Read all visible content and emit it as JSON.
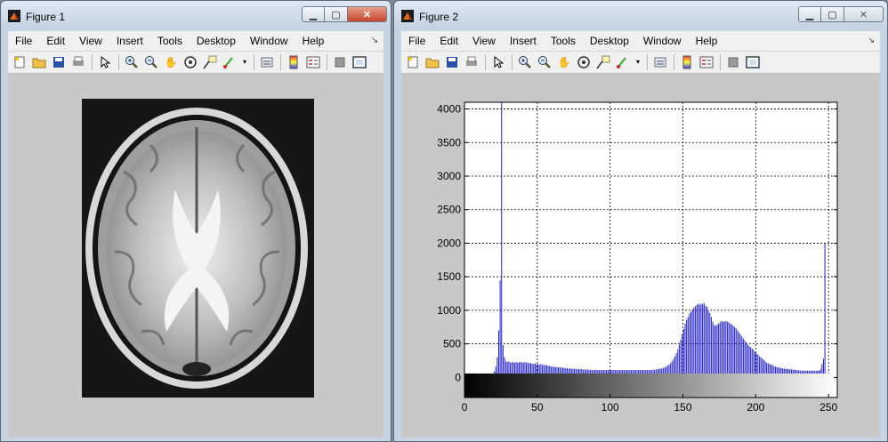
{
  "figure1": {
    "title": "Figure 1",
    "menu": [
      "File",
      "Edit",
      "View",
      "Insert",
      "Tools",
      "Desktop",
      "Window",
      "Help"
    ]
  },
  "figure2": {
    "title": "Figure 2",
    "menu": [
      "File",
      "Edit",
      "View",
      "Insert",
      "Tools",
      "Desktop",
      "Window",
      "Help"
    ]
  },
  "toolbar_icons": [
    "new-file-icon",
    "open-folder-icon",
    "save-icon",
    "print-icon",
    "pointer-icon",
    "zoom-in-icon",
    "zoom-out-icon",
    "pan-hand-icon",
    "rotate-3d-icon",
    "data-cursor-icon",
    "brush-icon",
    "link-icon",
    "colorbar-icon",
    "legend-icon",
    "hide-plot-tools-icon",
    "show-plot-tools-icon"
  ],
  "colors": {
    "histogram_bar": "#1f1fd0",
    "close_button_active": "#c7452a",
    "figure_background": "#c8c8c8"
  },
  "chart_data": {
    "type": "bar",
    "title": "",
    "xlabel": "",
    "ylabel": "",
    "xlim": [
      0,
      256
    ],
    "ylim": [
      -300,
      4100
    ],
    "xticks": [
      0,
      50,
      100,
      150,
      200,
      250
    ],
    "yticks": [
      0,
      500,
      1000,
      1500,
      2000,
      2500,
      3000,
      3500,
      4000
    ],
    "grid": true,
    "colorbar": "grayscale 0-255 under x axis",
    "x_range": [
      0,
      255
    ],
    "values": [
      0,
      0,
      0,
      0,
      0,
      0,
      0,
      0,
      0,
      0,
      0,
      0,
      0,
      0,
      0,
      0,
      0,
      10,
      20,
      40,
      90,
      160,
      300,
      700,
      1450,
      4100,
      480,
      300,
      240,
      230,
      240,
      220,
      225,
      230,
      215,
      230,
      220,
      225,
      230,
      225,
      220,
      230,
      215,
      225,
      210,
      215,
      205,
      200,
      210,
      195,
      200,
      190,
      200,
      185,
      190,
      180,
      185,
      170,
      175,
      160,
      165,
      155,
      160,
      150,
      150,
      145,
      150,
      140,
      145,
      135,
      140,
      130,
      135,
      125,
      130,
      125,
      130,
      120,
      125,
      120,
      125,
      115,
      120,
      115,
      120,
      110,
      115,
      110,
      115,
      110,
      115,
      110,
      110,
      110,
      110,
      110,
      110,
      110,
      110,
      110,
      110,
      110,
      110,
      110,
      110,
      110,
      110,
      110,
      110,
      110,
      110,
      110,
      110,
      110,
      110,
      110,
      110,
      110,
      110,
      110,
      110,
      110,
      110,
      110,
      110,
      110,
      110,
      110,
      110,
      115,
      115,
      120,
      120,
      125,
      130,
      135,
      140,
      150,
      160,
      175,
      190,
      210,
      240,
      270,
      310,
      360,
      420,
      490,
      560,
      640,
      720,
      800,
      860,
      900,
      950,
      980,
      1010,
      1040,
      1060,
      1080,
      1100,
      1080,
      1100,
      1090,
      1110,
      1070,
      1050,
      1000,
      960,
      900,
      830,
      780,
      770,
      790,
      800,
      820,
      840,
      830,
      830,
      840,
      830,
      820,
      800,
      790,
      770,
      750,
      730,
      700,
      670,
      640,
      610,
      580,
      550,
      520,
      490,
      470,
      450,
      430,
      410,
      380,
      360,
      340,
      310,
      300,
      280,
      260,
      240,
      220,
      210,
      200,
      190,
      180,
      170,
      160,
      155,
      150,
      145,
      140,
      135,
      130,
      130,
      125,
      125,
      120,
      120,
      115,
      115,
      110,
      110,
      105,
      105,
      100,
      100,
      100,
      100,
      100,
      100,
      100,
      100,
      100,
      100,
      100,
      100,
      100,
      120,
      200,
      280,
      2000
    ]
  }
}
